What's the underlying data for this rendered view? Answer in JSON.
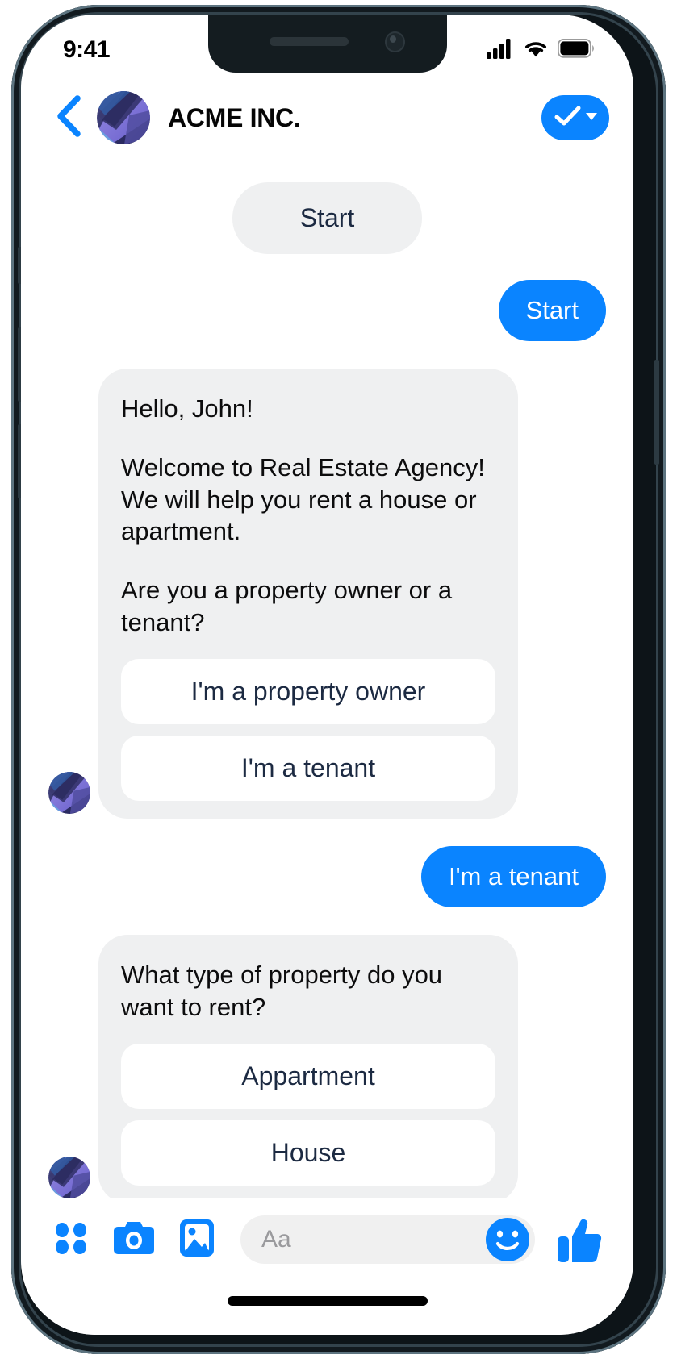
{
  "device": {
    "status_bar": {
      "time": "9:41",
      "cellular_icon": "signal-bars-icon",
      "wifi_icon": "wifi-icon",
      "battery_icon": "battery-full-icon"
    },
    "home_indicator": "home-indicator"
  },
  "header": {
    "back_icon": "chevron-left-icon",
    "avatar": "acme-logo-avatar",
    "title": "ACME INC.",
    "badge": {
      "check_icon": "checkmark-icon",
      "caret_icon": "caret-down-icon"
    }
  },
  "conversation": {
    "items": [
      {
        "type": "system_pill",
        "text": "Start"
      },
      {
        "type": "outgoing",
        "text": "Start"
      },
      {
        "type": "incoming",
        "paragraphs": [
          "Hello, John!",
          "Welcome to Real Estate Agency! We will help you rent a house or apartment.",
          "Are you a property owner or a tenant?"
        ],
        "quick_replies": [
          "I'm a property owner",
          "I'm a tenant"
        ]
      },
      {
        "type": "outgoing",
        "text": "I'm a tenant"
      },
      {
        "type": "incoming",
        "paragraphs": [
          "What type of property do you want to rent?"
        ],
        "quick_replies": [
          "Appartment",
          "House"
        ]
      }
    ]
  },
  "toolbar": {
    "menu_icon": "four-dots-grid-icon",
    "camera_icon": "camera-icon",
    "gallery_icon": "image-icon",
    "input_placeholder": "Aa",
    "emoji_icon": "smiley-face-icon",
    "like_icon": "thumbs-up-icon"
  },
  "colors": {
    "accent_blue": "#0a84ff",
    "bubble_gray": "#eff0f1",
    "quick_reply_text": "#1c2a42",
    "frame_dark": "#0d1418"
  }
}
